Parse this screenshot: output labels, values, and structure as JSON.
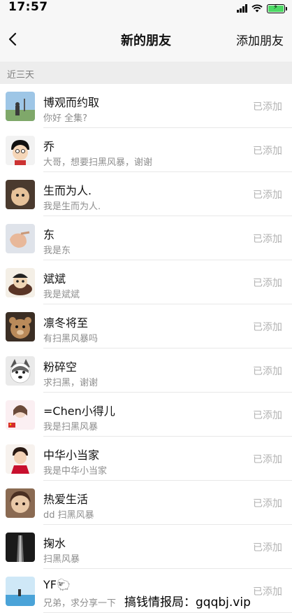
{
  "status_bar": {
    "time": "17:57"
  },
  "nav": {
    "back_icon": "chevron-left-icon",
    "title": "新的朋友",
    "action": "添加朋友"
  },
  "section": {
    "title": "近三天"
  },
  "friends": [
    {
      "name": "博观而约取",
      "message": "你好 全集?",
      "status": "已添加"
    },
    {
      "name": "乔",
      "message": "大哥，想要扫黑风暴，谢谢",
      "status": "已添加"
    },
    {
      "name": "生而为人.",
      "message": "我是生而为人.",
      "status": "已添加"
    },
    {
      "name": "东",
      "message": "我是东",
      "status": "已添加"
    },
    {
      "name": "斌斌",
      "message": "我是斌斌",
      "status": "已添加"
    },
    {
      "name": "凛冬将至",
      "message": "有扫黑风暴吗",
      "status": "已添加"
    },
    {
      "name": "粉碎空",
      "message": "求扫黑，谢谢",
      "status": "已添加"
    },
    {
      "name": "=Chen小得儿",
      "message": "我是扫黑风暴",
      "status": "已添加"
    },
    {
      "name": "中华小当家",
      "message": "我是中华小当家",
      "status": "已添加"
    },
    {
      "name": "热爱生活",
      "message": "dd 扫黑风暴",
      "status": "已添加"
    },
    {
      "name": "掬水",
      "message": "扫黑风暴",
      "status": "已添加"
    },
    {
      "name": "YF🐑",
      "message": "兄弟，求分享一下",
      "status": "已添加"
    }
  ],
  "watermark": "搞钱情报局：gqqbj.vip"
}
